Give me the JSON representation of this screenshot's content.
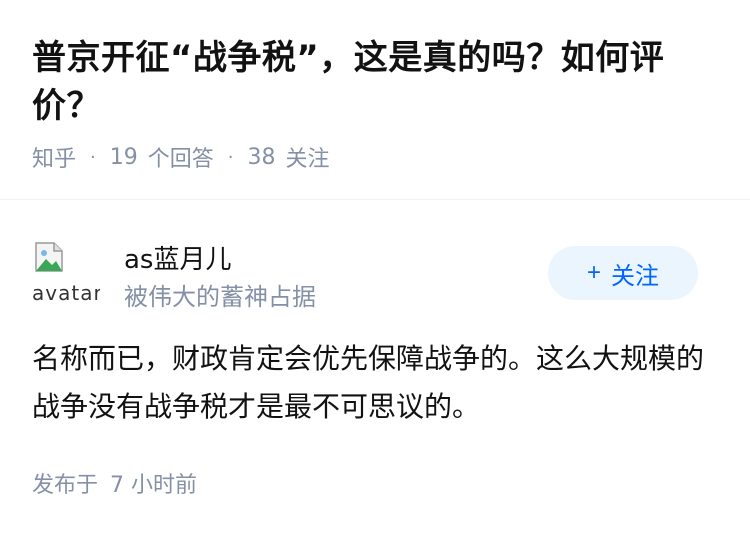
{
  "question": {
    "title": "普京开征“战争税”，这是真的吗？如何评价？",
    "source": "知乎",
    "answer_count": "19",
    "answer_label": "个回答",
    "follow_count": "38",
    "follow_label": "关注"
  },
  "answer": {
    "author": {
      "avatar_alt": "avatar",
      "name": "as蓝月儿",
      "bio": "被伟大的蓄神占据"
    },
    "follow_button": {
      "icon": "+",
      "label": "关注"
    },
    "content": "名称而已，财政肯定会优先保障战争的。这么大规模的战争没有战争税才是最不可思议的。",
    "published_prefix": "发布于",
    "published_time": "7 小时前"
  },
  "colors": {
    "accent": "#0066ff",
    "button_bg": "#ebf5fd",
    "meta_text": "#8590a6"
  }
}
